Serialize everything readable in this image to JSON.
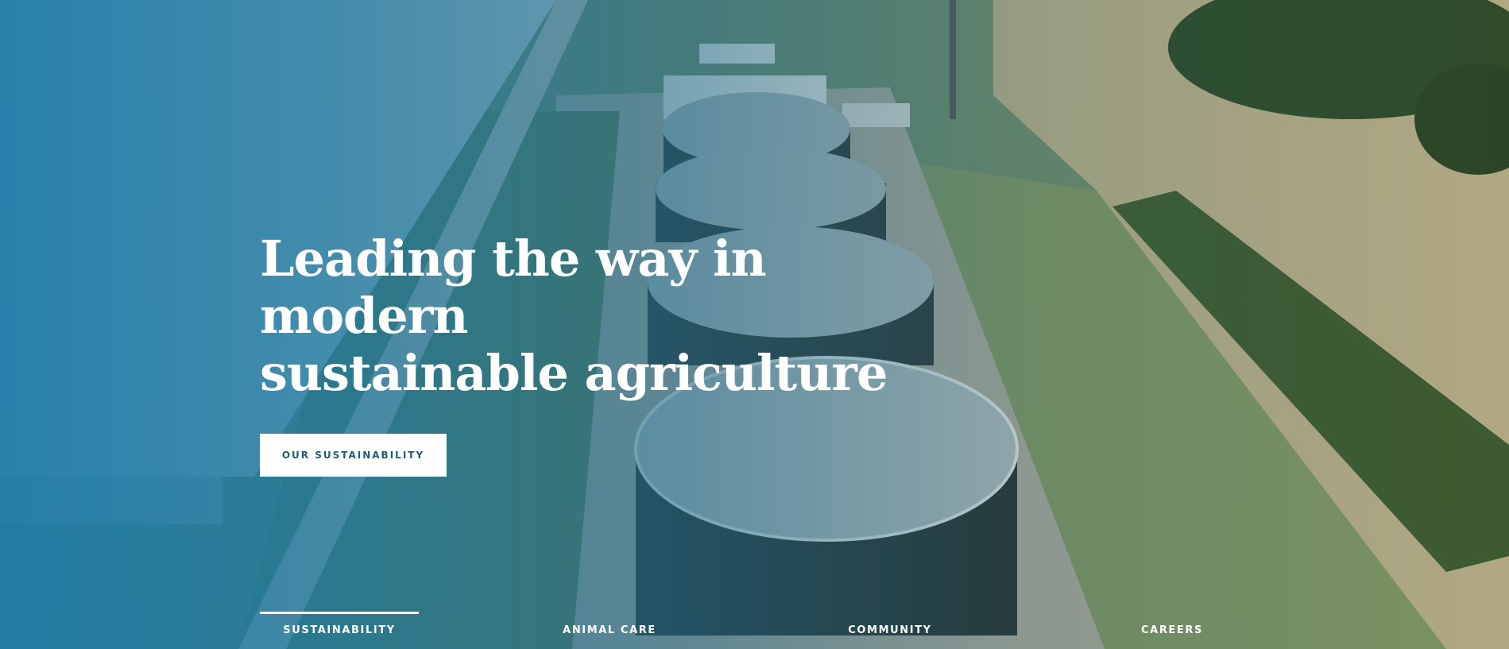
{
  "hero": {
    "title_line1": "Leading the way in modern",
    "title_line2": "sustainable agriculture",
    "cta_label": "OUR SUSTAINABILITY",
    "background_image": "aerial-biogas-digester-farm-photo"
  },
  "tabs": [
    {
      "label": "SUSTAINABILITY",
      "active": true
    },
    {
      "label": "ANIMAL CARE",
      "active": false
    },
    {
      "label": "COMMUNITY",
      "active": false
    },
    {
      "label": "CAREERS",
      "active": false
    }
  ],
  "colors": {
    "overlay_blue": "#1a7aa8",
    "cta_text": "#1f5a76",
    "text_white": "#ffffff"
  }
}
